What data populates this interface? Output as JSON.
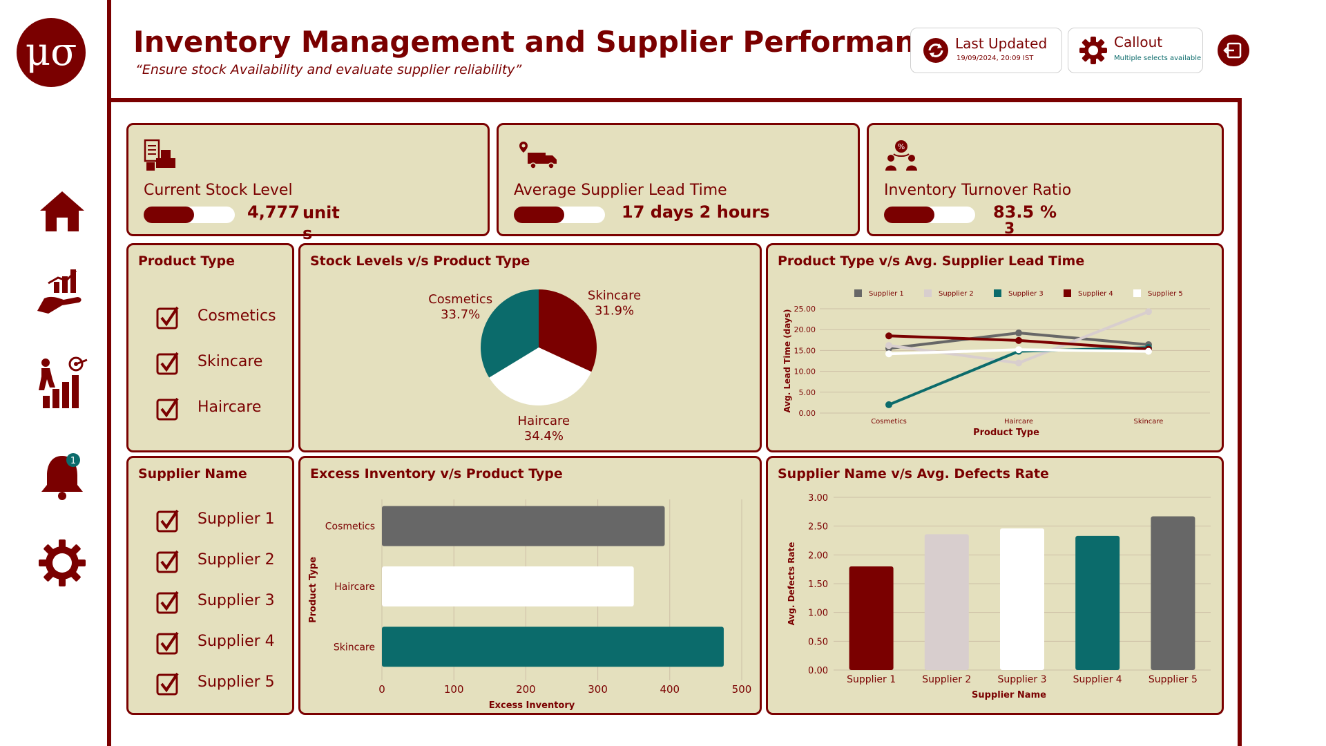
{
  "header": {
    "title": "Inventory Management and Supplier Performance",
    "subtitle": "“Ensure stock Availability and evaluate supplier reliability”",
    "last_updated_label": "Last Updated",
    "last_updated_value": "19/09/2024, 20:09 IST",
    "callout_label": "Callout",
    "callout_sub": "Multiple selects available",
    "logo_text": "μσ"
  },
  "colors": {
    "accent": "#7a0000",
    "panel": "#e4e0be",
    "teal": "#0b6b6b",
    "grey": "#676767",
    "pink": "#d8cece",
    "white": "#ffffff"
  },
  "sidebar": {
    "items": [
      {
        "icon": "home-icon"
      },
      {
        "icon": "hand-chart-icon"
      },
      {
        "icon": "growth-target-icon"
      },
      {
        "icon": "bell-icon",
        "badge": "1"
      },
      {
        "icon": "gear-icon"
      }
    ]
  },
  "kpis": [
    {
      "label": "Current Stock Level",
      "value": "4,777",
      "unit": "units",
      "fill": 0.55,
      "icon": "inventory-boxes-icon"
    },
    {
      "label": "Average Supplier Lead Time",
      "value": "17 days 2 hours",
      "unit": "",
      "fill": 0.55,
      "icon": "delivery-truck-icon"
    },
    {
      "label": "Inventory Turnover Ratio",
      "value": "83.5",
      "unit": "%",
      "extra": "3",
      "fill": 0.55,
      "icon": "turnover-people-icon"
    }
  ],
  "filters": {
    "product_type": {
      "title": "Product Type",
      "options": [
        "Cosmetics",
        "Skincare",
        "Haircare"
      ]
    },
    "supplier": {
      "title": "Supplier Name",
      "options": [
        "Supplier 1",
        "Supplier 2",
        "Supplier 3",
        "Supplier 4",
        "Supplier 5"
      ]
    }
  },
  "chart_data": [
    {
      "type": "pie",
      "title": "Stock Levels v/s Product Type",
      "slices": [
        {
          "name": "Skincare",
          "value": 31.9,
          "label": "31.9%",
          "color": "#7a0000"
        },
        {
          "name": "Haircare",
          "value": 34.4,
          "label": "34.4%",
          "color": "#ffffff"
        },
        {
          "name": "Cosmetics",
          "value": 33.7,
          "label": "33.7%",
          "color": "#0b6b6b"
        }
      ]
    },
    {
      "type": "line",
      "title": "Product Type v/s Avg. Supplier Lead Time",
      "xlabel": "Product Type",
      "ylabel": "Avg. Lead Time (days)",
      "categories": [
        "Cosmetics",
        "Haircare",
        "Skincare"
      ],
      "ylim": [
        0,
        25
      ],
      "yticks": [
        "0.00",
        "5.00",
        "10.00",
        "15.00",
        "20.00",
        "25.00"
      ],
      "series": [
        {
          "name": "Supplier 1",
          "values": [
            15.5,
            19.2,
            16.4
          ],
          "color": "#676767"
        },
        {
          "name": "Supplier 2",
          "values": [
            16.2,
            12.0,
            24.3
          ],
          "color": "#d8cece"
        },
        {
          "name": "Supplier 3",
          "values": [
            2.0,
            14.8,
            15.7
          ],
          "color": "#0b6b6b"
        },
        {
          "name": "Supplier 4",
          "values": [
            18.5,
            17.4,
            15.3
          ],
          "color": "#7a0000"
        },
        {
          "name": "Supplier 5",
          "values": [
            14.2,
            15.2,
            14.8
          ],
          "color": "#ffffff"
        }
      ]
    },
    {
      "type": "bar",
      "orientation": "horizontal",
      "title": "Excess Inventory v/s Product Type",
      "xlabel": "Excess Inventory",
      "ylabel": "Product Type",
      "categories": [
        "Cosmetics",
        "Haircare",
        "Skincare"
      ],
      "values": [
        393,
        350,
        475
      ],
      "colors": [
        "#676767",
        "#ffffff",
        "#0b6b6b"
      ],
      "xlim": [
        0,
        500
      ],
      "xticks": [
        "0",
        "100",
        "200",
        "300",
        "400",
        "500"
      ]
    },
    {
      "type": "bar",
      "title": "Supplier Name v/s Avg. Defects Rate",
      "xlabel": "Supplier Name",
      "ylabel": "Avg. Defects Rate",
      "categories": [
        "Supplier 1",
        "Supplier 2",
        "Supplier 3",
        "Supplier 4",
        "Supplier 5"
      ],
      "values": [
        1.8,
        2.36,
        2.46,
        2.33,
        2.67
      ],
      "colors": [
        "#7a0000",
        "#d8cece",
        "#ffffff",
        "#0b6b6b",
        "#676767"
      ],
      "ylim": [
        0,
        3
      ],
      "yticks": [
        "0.00",
        "0.50",
        "1.00",
        "1.50",
        "2.00",
        "2.50",
        "3.00"
      ]
    }
  ]
}
